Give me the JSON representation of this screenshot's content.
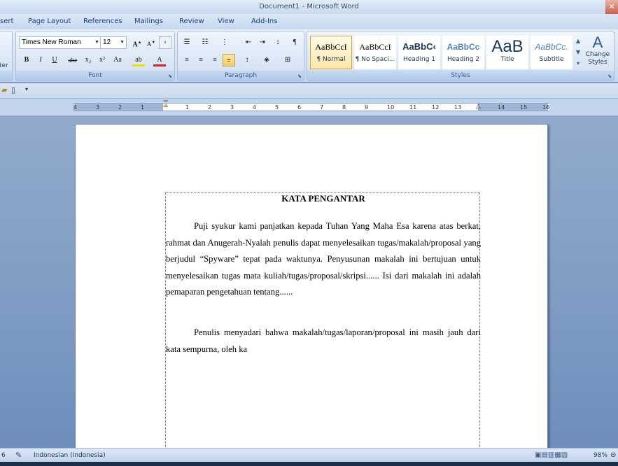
{
  "window": {
    "title": "Document1 - Microsoft Word"
  },
  "tabs": [
    "sert",
    "Page Layout",
    "References",
    "Mailings",
    "Review",
    "View",
    "Add-Ins"
  ],
  "ribbon": {
    "clipboard_partial_label": "ter",
    "font": {
      "family": "Times New Roman",
      "size": "12",
      "group_label": "Font",
      "buttons": [
        "B",
        "I",
        "U",
        "abe",
        "x₂",
        "x²",
        "Aa"
      ]
    },
    "paragraph": {
      "group_label": "Paragraph"
    },
    "styles": {
      "group_label": "Styles",
      "items": [
        {
          "sample": "AaBbCcI",
          "name": "¶ Normal"
        },
        {
          "sample": "AaBbCcI",
          "name": "¶ No Spaci..."
        },
        {
          "sample": "AaBbC‹",
          "name": "Heading 1"
        },
        {
          "sample": "AaBbCc",
          "name": "Heading 2"
        },
        {
          "sample": "AaB",
          "name": "Title"
        },
        {
          "sample": "AaBbCc.",
          "name": "Subtitle"
        }
      ],
      "change_styles": "Change Styles"
    }
  },
  "ruler": {
    "left_numbers": [
      "4",
      "3",
      "2",
      "1"
    ],
    "right_numbers": [
      "1",
      "2",
      "3",
      "4",
      "5",
      "6",
      "7",
      "8",
      "9",
      "10",
      "11",
      "12",
      "13",
      "14",
      "15",
      "16"
    ]
  },
  "document": {
    "title": "KATA PENGANTAR",
    "para1": "Puji syukur kami panjatkan kepada Tuhan Yang Maha Esa karena atas berkat, rahmat dan Anugerah-Nyalah penulis dapat menyelesaikan tugas/makalah/proposal yang berjudul “Spyware” tepat pada waktunya. Penyusunan makalah ini bertujuan untuk menyelesaikan tugas mata kuliah/tugas/proposal/skripsi...... Isi dari makalah ini adalah pemaparan pengetahuan tentang......",
    "para2": "Penulis menyadari bahwa makalah/tugas/laporan/proposal ini masih jauh dari kata sempurna, oleh ka"
  },
  "status": {
    "page_fragment": "6",
    "language": "Indonesian (Indonesia)",
    "zoom": "98%"
  }
}
